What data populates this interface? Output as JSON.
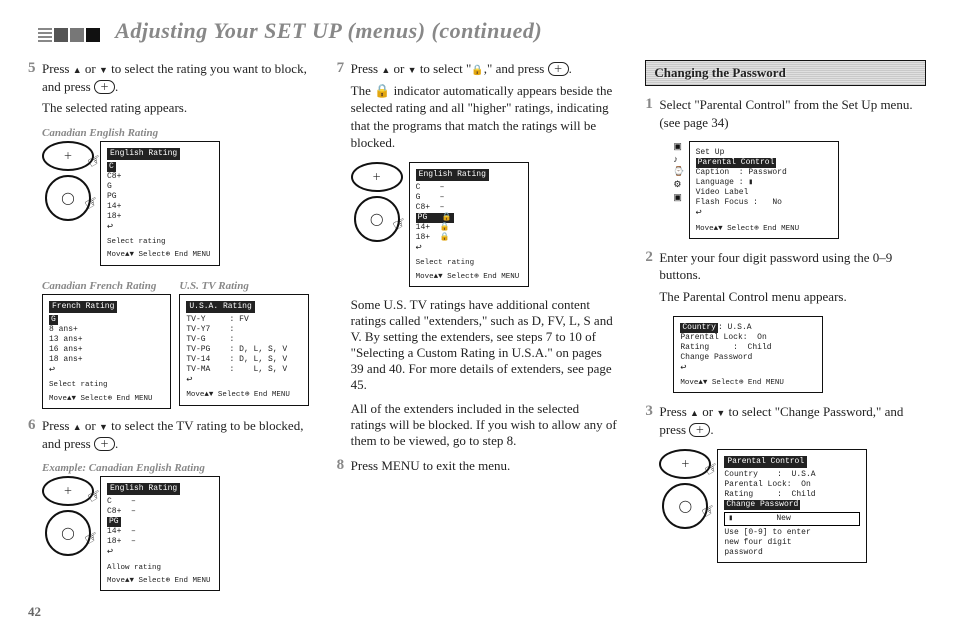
{
  "page": {
    "title": "Adjusting Your SET UP (menus) (continued)",
    "number": "42"
  },
  "col1": {
    "step5": {
      "num": "5",
      "text_a": "Press ",
      "text_b": " or ",
      "text_c": " to select the rating you want to block, and press ",
      "text_d": ".",
      "text2": "The selected rating appears."
    },
    "fig5": {
      "caption": "Canadian English Rating",
      "osd_title": "English Rating",
      "items": [
        "C",
        "C8+",
        "G",
        "PG",
        "14+",
        "18+"
      ],
      "return": "↩",
      "foot1": "Select rating",
      "foot2": "Move▲▼  Select⊕  End MENU"
    },
    "twin": {
      "capL": "Canadian French Rating",
      "capR": "U.S. TV Rating",
      "osdL_title": "French Rating",
      "osdL_items": [
        "G",
        "8 ans+",
        "13 ans+",
        "16 ans+",
        "18 ans+"
      ],
      "osdR_title": "U.S.A. Rating",
      "osdR_rows": [
        "TV-Y     : FV",
        "TV-Y7    :",
        "TV-G     :",
        "TV-PG    : D, L, S, V",
        "TV-14    : D, L, S, V",
        "TV-MA    :    L, S, V"
      ],
      "foot1": "Select rating",
      "foot2": "Move▲▼  Select⊕  End MENU"
    },
    "step6": {
      "num": "6",
      "text_a": "Press ",
      "text_b": " or ",
      "text_c": " to select the TV rating to be blocked, and press ",
      "text_d": "."
    },
    "fig6": {
      "caption": "Example: Canadian English Rating",
      "osd_title": "English Rating",
      "rows": [
        "C    –",
        "C8+  –"
      ],
      "hl": "PG",
      "rows2": [
        "14+  –",
        "18+  –"
      ],
      "foot1": "Allow rating",
      "foot2": "Move▲▼  Select⊕  End MENU"
    }
  },
  "col2": {
    "step7": {
      "num": "7",
      "text_a": "Press ",
      "text_b": " or ",
      "text_c": " to select \"",
      "text_d": ",\" and press ",
      "text_e": ".",
      "para": "The 🔒 indicator automatically appears beside the selected rating and all \"higher\" ratings, indicating that the programs that match the ratings will be blocked."
    },
    "fig7": {
      "osd_title": "English Rating",
      "rows_top": [
        "C    –",
        "G    –",
        "C8+  –"
      ],
      "hl": "PG   🔒",
      "rows_bot": [
        "14+  🔒",
        "18+  🔒"
      ],
      "foot1": "Select rating",
      "foot2": "Move▲▼  Select⊕  End MENU"
    },
    "para_ext1": "Some U.S. TV ratings have additional content ratings called \"extenders,\" such as D, FV, L, S and V. By setting the extenders, see steps 7 to 10 of \"Selecting a Custom Rating in U.S.A.\" on pages 39 and 40. For more details of extenders, see page 45.",
    "para_ext2": "All of the extenders included in the selected ratings will be blocked. If you wish to allow any of them to be viewed, go to step 8.",
    "step8": {
      "num": "8",
      "text": "Press MENU to exit the menu."
    }
  },
  "col3": {
    "heading": "Changing the Password",
    "step1": {
      "num": "1",
      "text": "Select \"Parental Control\" from the Set Up menu. (see page 34)"
    },
    "fig1": {
      "title": "Set Up",
      "hl": "Parental Control",
      "rows": [
        "Caption  : Password",
        "Language : ▮",
        "Video Label",
        "Flash Focus :   No"
      ],
      "foot": "Move▲▼  Select⊕  End MENU"
    },
    "step2": {
      "num": "2",
      "text1": "Enter your four digit password using the 0–9 buttons.",
      "text2": "The Parental Control menu appears."
    },
    "fig2": {
      "title_hl": "Country",
      "title_val": ": U.S.A",
      "rows": [
        "Parental Lock:  On",
        "Rating     :  Child",
        "Change Password"
      ],
      "foot": "Move▲▼  Select⊕  End MENU"
    },
    "step3": {
      "num": "3",
      "text_a": "Press ",
      "text_b": " or ",
      "text_c": " to select \"Change Password,\" and press ",
      "text_d": "."
    },
    "fig3": {
      "title": "Parental Control",
      "rows_top": [
        "Country    :  U.S.A",
        "Parental Lock:  On",
        "Rating     :  Child"
      ],
      "hl": "Change Password",
      "box_row": "▮         New",
      "rows_bot": [
        "Use [0-9] to enter",
        "new four digit",
        "password"
      ]
    }
  },
  "icons": {
    "plus": "＋",
    "circle": "◯"
  }
}
